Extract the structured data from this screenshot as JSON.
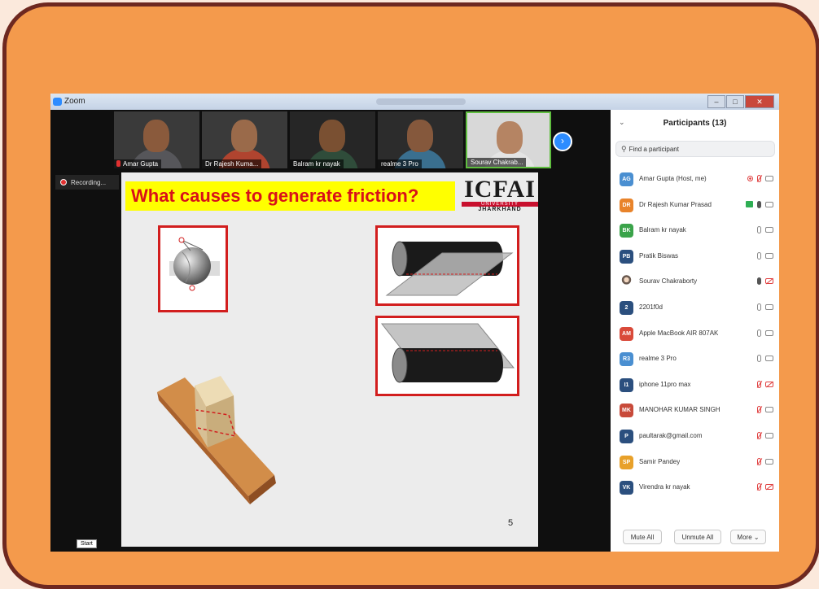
{
  "window": {
    "app_title": "Zoom"
  },
  "window_controls": [
    "–",
    "□",
    "✕"
  ],
  "videos": [
    {
      "name": "Amar Gupta",
      "muted": true
    },
    {
      "name": "Dr Rajesh Kuma...",
      "muted": false
    },
    {
      "name": "Balram kr nayak",
      "muted": false
    },
    {
      "name": "realme 3 Pro",
      "muted": false
    },
    {
      "name": "Sourav Chakrab...",
      "muted": false
    }
  ],
  "recording": {
    "label": "Recording..."
  },
  "slide": {
    "title": "What causes to generate friction?",
    "logo": {
      "text": "ICFAI",
      "band": "UNIVERSITY",
      "sub": "JHARKHAND"
    },
    "page_number": "5"
  },
  "start_label": "Start",
  "panel": {
    "title": "Participants (13)",
    "search_placeholder": "Find a participant",
    "participants": [
      {
        "initials": "AG",
        "name": "Amar Gupta (Host, me)",
        "color": "#4a8fd1",
        "mic": "off",
        "cam": "on",
        "rec": true
      },
      {
        "initials": "DR",
        "name": "Dr Rajesh Kumar Prasad",
        "color": "#e8832a",
        "mic": "on",
        "cam": "on",
        "share": true
      },
      {
        "initials": "BK",
        "name": "Balram kr nayak",
        "color": "#3aa34a",
        "mic": "idle",
        "cam": "on"
      },
      {
        "initials": "PB",
        "name": "Pratik Biswas",
        "color": "#2b4f7e",
        "mic": "idle",
        "cam": "on"
      },
      {
        "initials": "",
        "name": "Sourav Chakraborty",
        "color": "#9a7d6a",
        "mic": "on",
        "cam": "off",
        "photo": true
      },
      {
        "initials": "2",
        "name": "2201f0d",
        "color": "#2b4f7e",
        "mic": "idle",
        "cam": "on"
      },
      {
        "initials": "AM",
        "name": "Apple MacBook AIR 807AK",
        "color": "#d94a3a",
        "mic": "idle",
        "cam": "on"
      },
      {
        "initials": "R3",
        "name": "realme 3 Pro",
        "color": "#4a8fd1",
        "mic": "idle",
        "cam": "on"
      },
      {
        "initials": "I1",
        "name": "iphone 11pro max",
        "color": "#2b4f7e",
        "mic": "off",
        "cam": "off"
      },
      {
        "initials": "MK",
        "name": "MANOHAR KUMAR SINGH",
        "color": "#c84a3a",
        "mic": "off",
        "cam": "on"
      },
      {
        "initials": "P",
        "name": "paultarak@gmail.com",
        "color": "#2b4f7e",
        "mic": "off",
        "cam": "on"
      },
      {
        "initials": "SP",
        "name": "Samir Pandey",
        "color": "#e8a12a",
        "mic": "off",
        "cam": "on"
      },
      {
        "initials": "VK",
        "name": "Virendra kr nayak",
        "color": "#2b4f7e",
        "mic": "off",
        "cam": "off"
      }
    ],
    "footer": {
      "mute_all": "Mute All",
      "unmute_all": "Unmute All",
      "more": "More ⌄"
    }
  }
}
